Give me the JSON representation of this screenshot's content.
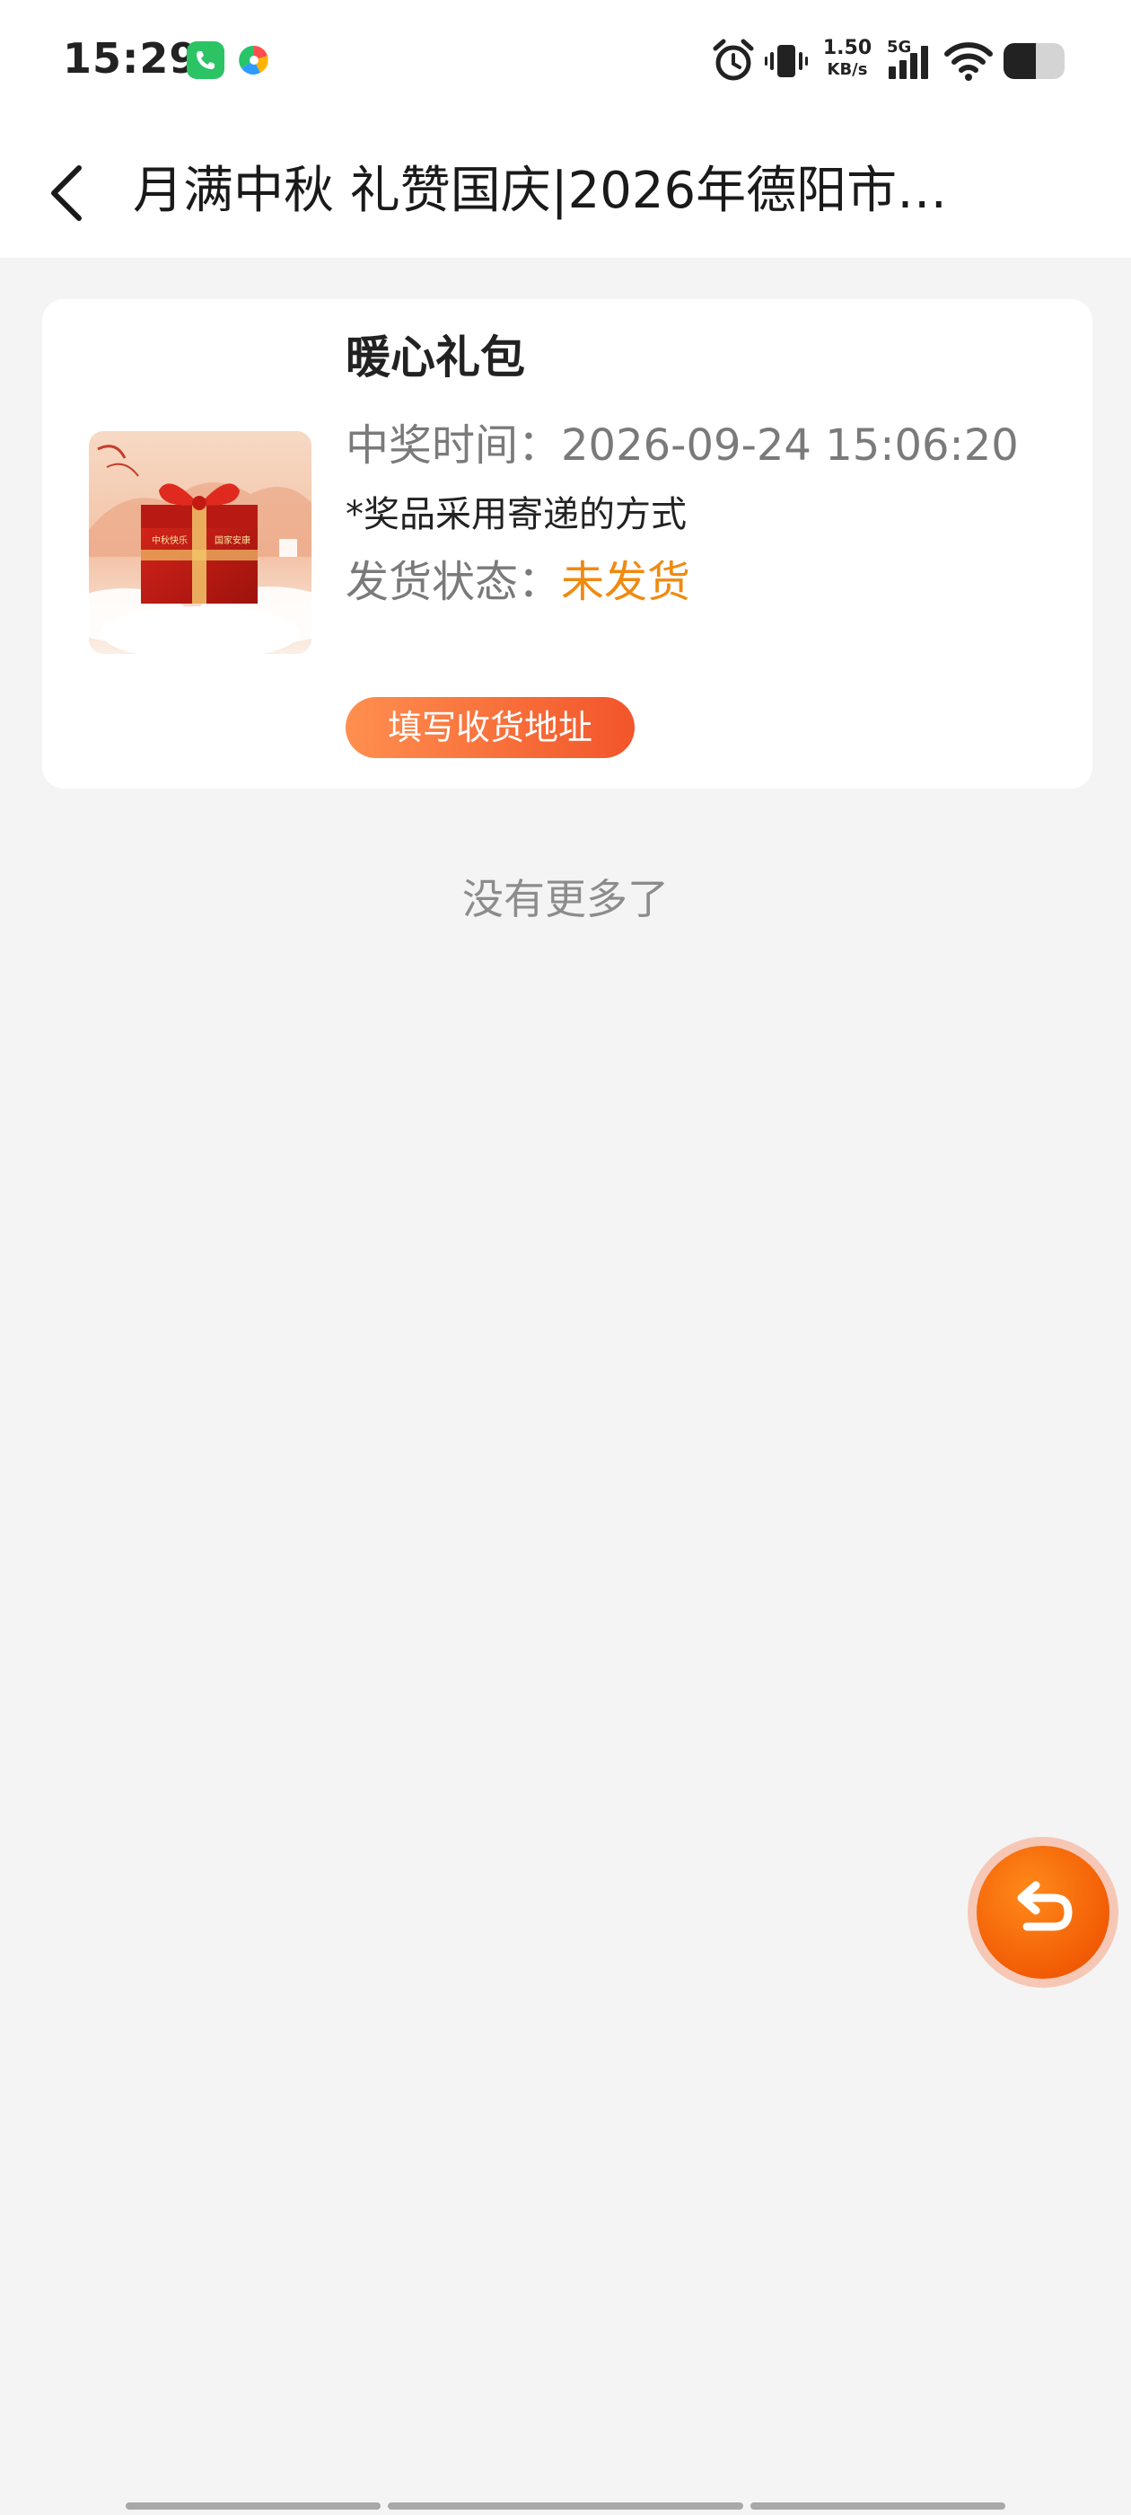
{
  "status_bar": {
    "time": "15:29",
    "network_speed_value": "1.50",
    "network_speed_unit": "KB/s",
    "network_type": "5G",
    "icons": [
      "phone-app-icon",
      "pinwheel-app-icon",
      "alarm-icon",
      "vibrate-icon",
      "signal-icon",
      "wifi-icon",
      "battery-icon"
    ]
  },
  "nav": {
    "back_icon": "chevron-left-icon",
    "title": "月满中秋 礼赞国庆|2026年德阳市…"
  },
  "prize": {
    "name": "暖心礼包",
    "win_time_label": "中奖时间：",
    "win_time_value": "2026-09-24 15:06:20",
    "delivery_note": "*奖品采用寄递的方式",
    "shipping_label": "发货状态：",
    "shipping_status": "未发货",
    "address_button": "填写收货地址",
    "image_box_text_left": "中秋快乐",
    "image_box_text_right": "国家安康",
    "status_color": "#f08a10",
    "button_gradient": [
      "#ff8f4f",
      "#f2552a"
    ]
  },
  "list_end_text": "没有更多了",
  "float_button": {
    "icon": "return-arrow-icon",
    "color": "#f25c05"
  }
}
